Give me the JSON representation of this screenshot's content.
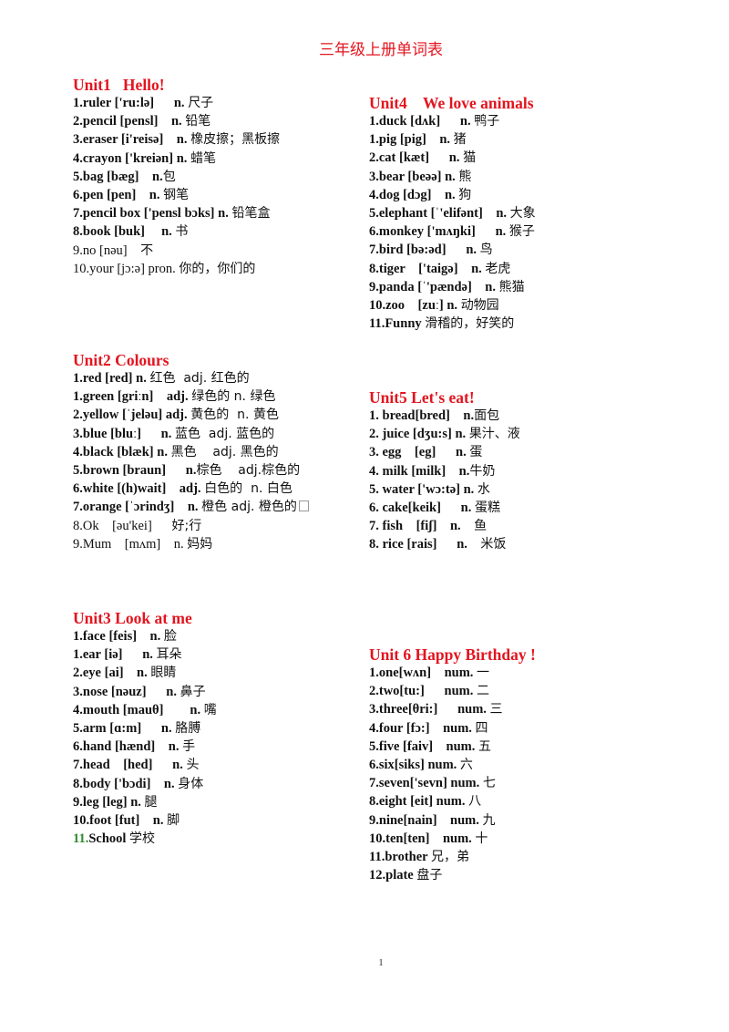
{
  "document": {
    "title": "三年级上册单词表",
    "page_number": "1"
  },
  "units": [
    {
      "id": "u1",
      "heading": "Unit1   Hello!",
      "entries": [
        {
          "num": "1.",
          "en": "ruler ['ru:lə]      n. ",
          "cn": "尺子",
          "bold": true
        },
        {
          "num": "2.",
          "en": "pencil [pensl]    n. ",
          "cn": "铅笔",
          "bold": true
        },
        {
          "num": "3.",
          "en": "eraser [i'reisə]    n. ",
          "cn": "橡皮擦；黑板擦",
          "bold": true
        },
        {
          "num": "4.",
          "en": "crayon ['kreiən] n. ",
          "cn": "蜡笔",
          "bold": true
        },
        {
          "num": "5.",
          "en": "bag [bæg]    n.",
          "cn": "包",
          "bold": true
        },
        {
          "num": "6.",
          "en": "pen [pen]    n. ",
          "cn": "钢笔",
          "bold": true
        },
        {
          "num": "7.",
          "en": "pencil box ['pensl bɔks] n. ",
          "cn": "铅笔盒",
          "bold": true
        },
        {
          "num": "8.",
          "en": "book [buk]     n. ",
          "cn": "书",
          "bold": true
        },
        {
          "num": "9.",
          "en": "no [nəu]    ",
          "cn": "不",
          "bold": false
        },
        {
          "num": "10.",
          "en": "your [jɔ:ə] pron. ",
          "cn": "你的，你们的",
          "bold": false
        }
      ]
    },
    {
      "id": "u4",
      "heading": "Unit4    We love animals",
      "entries": [
        {
          "num": "1.",
          "en": "duck [dʌk]      n. ",
          "cn": "鸭子",
          "bold": true
        },
        {
          "num": "1.",
          "en": "pig [pig]    n. ",
          "cn": "猪",
          "bold": true
        },
        {
          "num": "2.",
          "en": "cat [kæt]      n. ",
          "cn": "猫",
          "bold": true
        },
        {
          "num": "3.",
          "en": "bear [beəə] n. ",
          "cn": "熊",
          "bold": true
        },
        {
          "num": "4.",
          "en": "dog [dɔg]    n. ",
          "cn": "狗",
          "bold": true
        },
        {
          "num": "5.",
          "en": "elephant [ˈ'elifənt]    n. ",
          "cn": "大象",
          "bold": true
        },
        {
          "num": "6.",
          "en": "monkey ['mʌŋki]      n. ",
          "cn": "猴子",
          "bold": true
        },
        {
          "num": "7.",
          "en": "bird [bə:əd]      n. ",
          "cn": "鸟",
          "bold": true
        },
        {
          "num": "8.",
          "en": "tiger    ['taigə]    n. ",
          "cn": "老虎",
          "bold": true
        },
        {
          "num": "9.",
          "en": "panda [ˈ'pændə]    n. ",
          "cn": "熊猫",
          "bold": true
        },
        {
          "num": "10.",
          "en": "zoo    [zuː] n. ",
          "cn": "动物园",
          "bold": true
        },
        {
          "num": "11.",
          "en": "Funny ",
          "cn": "滑稽的，好笑的",
          "bold": true
        }
      ]
    },
    {
      "id": "u2",
      "heading": "Unit2 Colours",
      "entries": [
        {
          "num": "1.",
          "en": "red [red] n. ",
          "cn": "红色  adj. 红色的",
          "bold": true
        },
        {
          "num": "1.",
          "en": "green [griːn]    adj. ",
          "cn": "绿色的 n. 绿色",
          "bold": true
        },
        {
          "num": "2.",
          "en": "yellow [ˈjeləu] adj. ",
          "cn": "黄色的  n. 黄色",
          "bold": true
        },
        {
          "num": "3.",
          "en": "blue [bluː]      n. ",
          "cn": "蓝色  adj. 蓝色的",
          "bold": true
        },
        {
          "num": "4.",
          "en": "black [blæk] n. ",
          "cn": "黑色    adj. 黑色的",
          "bold": true
        },
        {
          "num": "5.",
          "en": "brown [braun]      n.",
          "cn": "棕色    adj.棕色的",
          "bold": true
        },
        {
          "num": "6.",
          "en": "white [(h)wait]    adj. ",
          "cn": "白色的  n. 白色",
          "bold": true
        },
        {
          "num": "7.",
          "en": "orange [ˈɔrindʒ]    n. ",
          "cn": "橙色 adj. 橙色的",
          "bold": true,
          "missing_glyph": true
        },
        {
          "num": "8.",
          "en": "Ok    [əu'kei]      ",
          "cn": "好;行",
          "bold": false
        },
        {
          "num": "9.",
          "en": "Mum    [mʌm]    n. ",
          "cn": "妈妈",
          "bold": false
        }
      ]
    },
    {
      "id": "u5",
      "heading": "Unit5 Let's eat!",
      "entries": [
        {
          "num": "1. ",
          "en": "bread[bred]    n.",
          "cn": "面包",
          "bold": true
        },
        {
          "num": "2. ",
          "en": "juice [dʒu:s] n. ",
          "cn": "果汁、液",
          "bold": true
        },
        {
          "num": "3. ",
          "en": "egg    [eg]      n. ",
          "cn": "蛋",
          "bold": true
        },
        {
          "num": "4. ",
          "en": "milk [milk]    n.",
          "cn": "牛奶",
          "bold": true
        },
        {
          "num": "5. ",
          "en": "water ['wɔ:tə] n. ",
          "cn": "水",
          "bold": true
        },
        {
          "num": "6. ",
          "en": "cake[keik]      n. ",
          "cn": "蛋糕",
          "bold": true
        },
        {
          "num": "7. ",
          "en": "fish    [fiʃ]    n.    ",
          "cn": "鱼",
          "bold": true
        },
        {
          "num": "8. ",
          "en": "rice [rais]      n.    ",
          "cn": "米饭",
          "bold": true
        }
      ]
    },
    {
      "id": "u3",
      "heading": "Unit3 Look at me",
      "entries": [
        {
          "num": "1.",
          "en": "face [feis]    n. ",
          "cn": "脸",
          "bold": true
        },
        {
          "num": "1.",
          "en": "ear [iə]      n. ",
          "cn": "耳朵",
          "bold": true
        },
        {
          "num": "2.",
          "en": "eye [ai]    n. ",
          "cn": "眼睛",
          "bold": true
        },
        {
          "num": "3.",
          "en": "nose [nəuz]      n. ",
          "cn": "鼻子",
          "bold": true
        },
        {
          "num": "4.",
          "en": "mouth [mauθ]        n. ",
          "cn": "嘴",
          "bold": true
        },
        {
          "num": "5.",
          "en": "arm [ɑ:m]      n. ",
          "cn": "胳膊",
          "bold": true
        },
        {
          "num": "6.",
          "en": "hand [hænd]    n. ",
          "cn": "手",
          "bold": true
        },
        {
          "num": "7.",
          "en": "head    [hed]      n. ",
          "cn": "头",
          "bold": true
        },
        {
          "num": "8.",
          "en": "body ['bɔdi]    n. ",
          "cn": "身体",
          "bold": true
        },
        {
          "num": "9.",
          "en": "leg [leg] n. ",
          "cn": "腿",
          "bold": true
        },
        {
          "num": "10.",
          "en": "foot [fut]    n. ",
          "cn": "脚",
          "bold": true
        },
        {
          "num": "11.",
          "en": "School ",
          "cn": "学校",
          "bold": true,
          "num_color": "green"
        }
      ]
    },
    {
      "id": "u6",
      "heading": "Unit 6 Happy Birthday !",
      "entries": [
        {
          "num": "1.",
          "en": "one[wʌn]    num. ",
          "cn": "一",
          "bold": true
        },
        {
          "num": "2.",
          "en": "two[tu:]      num. ",
          "cn": "二",
          "bold": true
        },
        {
          "num": "3.",
          "en": "three[θri:]      num. ",
          "cn": "三",
          "bold": true
        },
        {
          "num": "4.",
          "en": "four [fɔ:]    num. ",
          "cn": "四",
          "bold": true
        },
        {
          "num": "5.",
          "en": "five [faiv]    num. ",
          "cn": "五",
          "bold": true
        },
        {
          "num": "6.",
          "en": "six[siks] num. ",
          "cn": "六",
          "bold": true
        },
        {
          "num": "7.",
          "en": "seven['sevn] num. ",
          "cn": "七",
          "bold": true
        },
        {
          "num": "8.",
          "en": "eight [eit] num. ",
          "cn": "八",
          "bold": true
        },
        {
          "num": "9.",
          "en": "nine[nain]    num. ",
          "cn": "九",
          "bold": true
        },
        {
          "num": "10.",
          "en": "ten[ten]    num. ",
          "cn": "十",
          "bold": true
        },
        {
          "num": "11.",
          "en": "brother ",
          "cn": "兄，弟",
          "bold": true
        },
        {
          "num": "12.",
          "en": "plate ",
          "cn": "盘子",
          "bold": true
        }
      ]
    }
  ],
  "colors": {
    "heading": "#e3151f",
    "title": "#e3151f",
    "green_number": "#2e8b2e",
    "text": "#111111"
  }
}
